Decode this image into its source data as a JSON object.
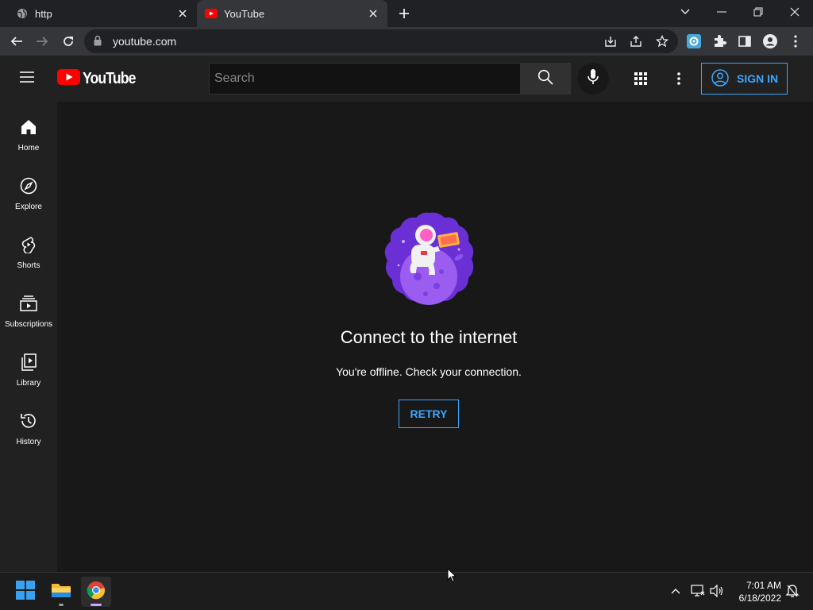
{
  "browser": {
    "tabs": [
      {
        "title": "http",
        "icon": "globe-icon",
        "active": false
      },
      {
        "title": "YouTube",
        "icon": "youtube-favicon",
        "active": true
      }
    ],
    "url": "youtube.com"
  },
  "masthead": {
    "logo_text": "YouTube",
    "search_placeholder": "Search",
    "signin_label": "SIGN IN"
  },
  "sidebar": {
    "items": [
      {
        "label": "Home",
        "icon": "home-icon"
      },
      {
        "label": "Explore",
        "icon": "compass-icon"
      },
      {
        "label": "Shorts",
        "icon": "shorts-icon"
      },
      {
        "label": "Subscriptions",
        "icon": "subscriptions-icon"
      },
      {
        "label": "Library",
        "icon": "library-icon"
      },
      {
        "label": "History",
        "icon": "history-icon"
      }
    ]
  },
  "main": {
    "heading": "Connect to the internet",
    "subtext": "You're offline. Check your connection.",
    "retry_label": "RETRY"
  },
  "taskbar": {
    "time": "7:01 AM",
    "date": "6/18/2022"
  },
  "colors": {
    "accent_blue": "#3ea6ff",
    "youtube_red": "#ff0000",
    "background": "#181818",
    "masthead": "#212121"
  }
}
